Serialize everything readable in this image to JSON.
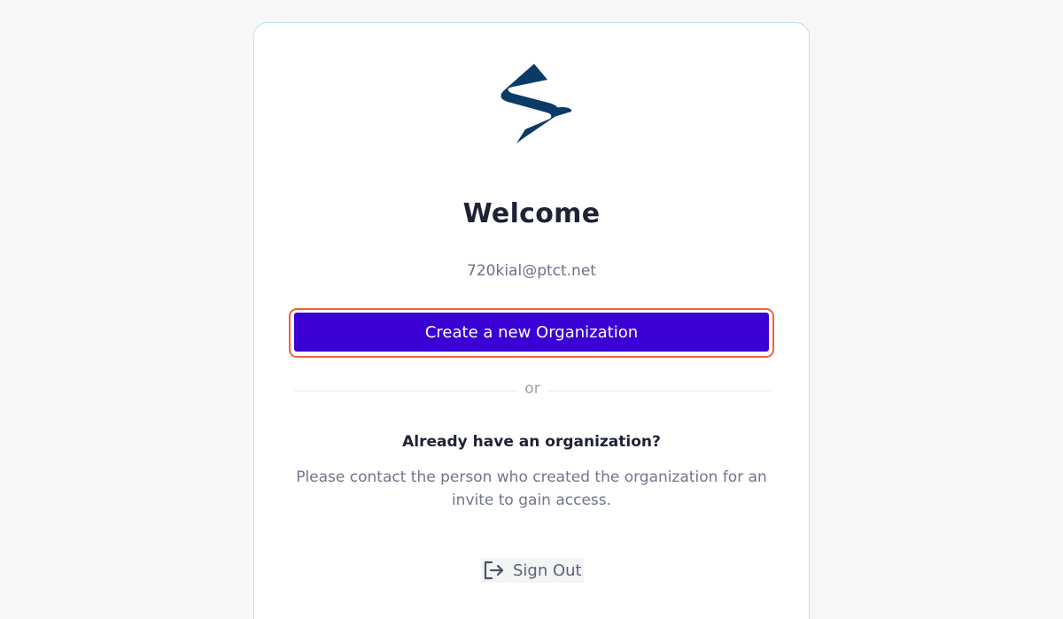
{
  "welcome": {
    "title": "Welcome",
    "email": "720kial@ptct.net",
    "create_button_label": "Create a new Organization",
    "divider_text": "or",
    "existing_org_heading": "Already have an organization?",
    "existing_org_description": "Please contact the person who created the organization for an invite to gain access.",
    "sign_out_label": "Sign Out"
  },
  "colors": {
    "primary": "#3a00d4",
    "brand_logo": "#0b3a66",
    "highlight": "#f4623a",
    "card_border": "#bfe0f2"
  },
  "icons": {
    "logo": "brand-logo-icon",
    "sign_out": "sign-out-icon"
  }
}
